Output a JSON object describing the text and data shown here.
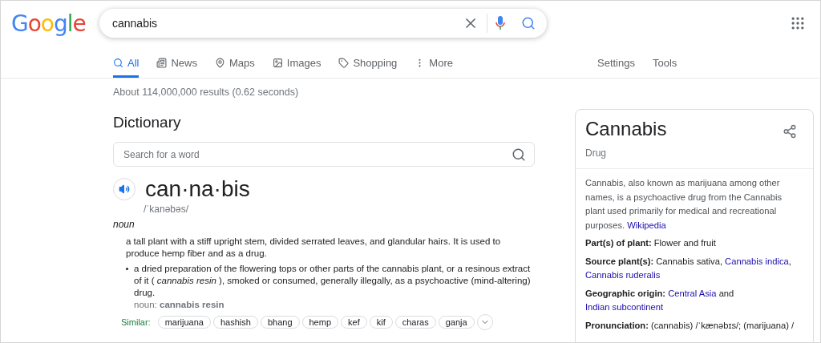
{
  "header": {
    "logo": "Google",
    "query": "cannabis"
  },
  "tabs": [
    {
      "label": "All",
      "kind": "search",
      "selected": true
    },
    {
      "label": "News",
      "kind": "news",
      "selected": false
    },
    {
      "label": "Maps",
      "kind": "pin",
      "selected": false
    },
    {
      "label": "Images",
      "kind": "image",
      "selected": false
    },
    {
      "label": "Shopping",
      "kind": "tag",
      "selected": false
    },
    {
      "label": "More",
      "kind": "dots",
      "selected": false
    }
  ],
  "tools": [
    "Settings",
    "Tools"
  ],
  "result_stats": "About 114,000,000 results (0.62 seconds)",
  "dictionary": {
    "heading": "Dictionary",
    "search_placeholder": "Search for a word",
    "headword": "can·na·bis",
    "phonetic": "/ˈkanəbəs/",
    "part_of_speech": "noun",
    "definitions": [
      {
        "text": "a tall plant with a stiff upright stem, divided serrated leaves, and glandular hairs. It is used to produce hemp fiber and as a drug.",
        "bullet": false
      },
      {
        "text": "a dried preparation of the flowering tops or other parts of the cannabis plant, or a resinous extract of it ( *cannabis resin* ), smoked or consumed, generally illegally, as a psychoactive (mind-altering) drug.",
        "bullet": true,
        "noun_label": "noun:",
        "noun": "cannabis resin"
      }
    ],
    "similar_label": "Similar:",
    "similar": [
      "marijuana",
      "hashish",
      "bhang",
      "hemp",
      "kef",
      "kif",
      "charas",
      "ganja"
    ]
  },
  "panel": {
    "title": "Cannabis",
    "subtitle": "Drug",
    "description": "Cannabis, also known as marijuana among other names, is a psychoactive drug from the Cannabis plant used primarily for medical and recreational purposes.",
    "source_link": "Wikipedia",
    "facts": [
      {
        "label": "Part(s) of plant:",
        "parts": [
          {
            "kind": "text",
            "text": "Flower and fruit"
          }
        ]
      },
      {
        "label": "Source plant(s):",
        "parts": [
          {
            "kind": "text",
            "text": "Cannabis sativa,"
          },
          {
            "kind": "link",
            "text": "Cannabis indica"
          },
          {
            "kind": "text",
            "text": ","
          },
          {
            "kind": "link",
            "text": "Cannabis ruderalis"
          }
        ]
      },
      {
        "label": "Geographic origin:",
        "parts": [
          {
            "kind": "link",
            "text": "Central Asia"
          },
          {
            "kind": "text",
            "text": "and"
          },
          {
            "kind": "link",
            "text": "Indian subcontinent"
          }
        ]
      },
      {
        "label": "Pronunciation:",
        "parts": [
          {
            "kind": "text",
            "text": "(cannabis) /ˈkænəbɪs/; (marijuana) /"
          }
        ]
      }
    ]
  }
}
